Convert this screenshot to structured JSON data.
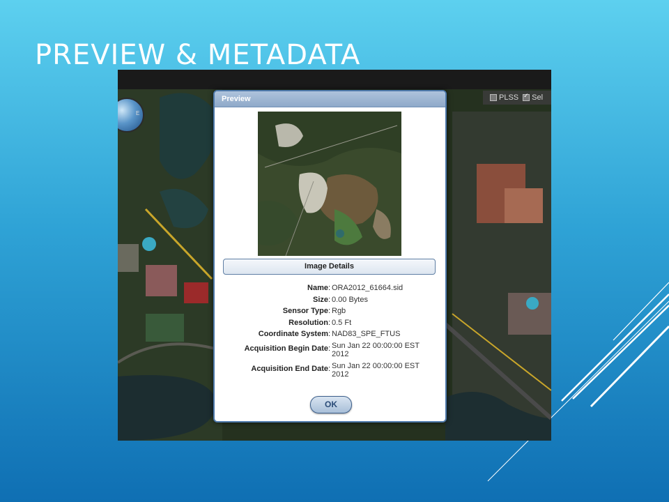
{
  "slide": {
    "title": "PREVIEW & METADATA"
  },
  "map": {
    "layers": [
      {
        "label": "PLSS",
        "checked": false
      },
      {
        "label": "Sel",
        "checked": true
      }
    ],
    "compass_letter": "E"
  },
  "dialog": {
    "title": "Preview",
    "section_title": "Image Details",
    "details": [
      {
        "label": "Name",
        "value": "ORA2012_61664.sid"
      },
      {
        "label": "Size",
        "value": "0.00 Bytes"
      },
      {
        "label": "Sensor Type",
        "value": "Rgb"
      },
      {
        "label": "Resolution",
        "value": "0.5 Ft"
      },
      {
        "label": "Coordinate System",
        "value": "NAD83_SPE_FTUS"
      },
      {
        "label": "Acquisition Begin Date",
        "value": "Sun Jan 22 00:00:00 EST 2012"
      },
      {
        "label": "Acquisition End Date",
        "value": "Sun Jan 22 00:00:00 EST 2012"
      }
    ],
    "ok_label": "OK"
  },
  "colors": {
    "dialog_border": "#4e79ab",
    "header": "#9db6d3",
    "road": "#c9a62a"
  }
}
